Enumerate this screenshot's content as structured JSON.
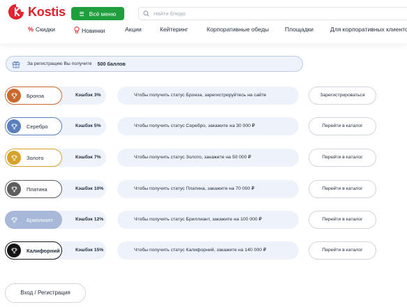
{
  "header": {
    "logo_text": "Kostis",
    "menu_button": "Всё меню",
    "search_placeholder": "Найти блюдо",
    "nav": [
      {
        "label": "Скидки",
        "icon": "percent-icon"
      },
      {
        "label": "Новинки",
        "icon": "bulb-icon"
      },
      {
        "label": "Акции"
      },
      {
        "label": "Кейтеринг"
      },
      {
        "label": "Корпоративные обеды"
      },
      {
        "label": "Площадки"
      },
      {
        "label": "Для корпоративных клиентов"
      }
    ]
  },
  "banner": {
    "text": "За регистрацию Вы получите",
    "points": "500 баллов"
  },
  "levels": [
    {
      "name": "Бронза",
      "cashback": "Кэшбэк 3%",
      "condition": "Чтобы получить статус Бронза, зарегистрируйтесь на сайте",
      "action": "Зарегистрироваться",
      "color": "#c8692e",
      "filled": false
    },
    {
      "name": "Серебро",
      "cashback": "Кэшбэк 5%",
      "condition": "Чтобы получить статус Серебро, закажите на 30 000 ₽",
      "action": "Перейти в каталог",
      "color": "#5b7fbd",
      "filled": false
    },
    {
      "name": "Золото",
      "cashback": "Кэшбэк 7%",
      "condition": "Чтобы получить статус Золото, закажите на 50 000 ₽",
      "action": "Перейти в каталог",
      "color": "#d6a229",
      "filled": false
    },
    {
      "name": "Платина",
      "cashback": "Кэшбэк 10%",
      "condition": "Чтобы получить статус Платина, закажите на 70 000 ₽",
      "action": "Перейти в каталог",
      "color": "#5d5d5d",
      "filled": false
    },
    {
      "name": "Бриллиант",
      "cashback": "Кэшбэк 12%",
      "condition": "Чтобы получить статус Бриллиант, закажите на 100 000 ₽",
      "action": "Перейти в каталог",
      "color": "#a7b8d8",
      "filled": true
    },
    {
      "name": "Калифорний",
      "cashback": "Кэшбэк 15%",
      "condition": "Чтобы получить статус Калифорний, закажите на 140 000 ₽",
      "action": "Перейти в каталог",
      "color": "#151515",
      "filled": false
    }
  ],
  "login_button": "Вход / Регистрация",
  "colors": {
    "brand_red": "#e4202c",
    "menu_green": "#1e9e3c",
    "pill_bg": "#eef3fb"
  }
}
